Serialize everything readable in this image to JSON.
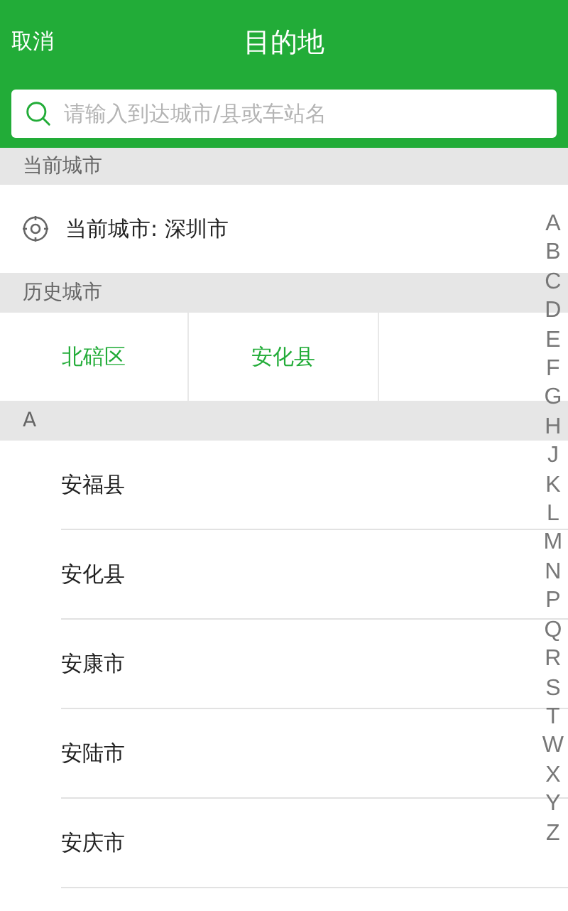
{
  "header": {
    "cancel": "取消",
    "title": "目的地"
  },
  "search": {
    "placeholder": "请输入到达城市/县或车站名"
  },
  "current_section": {
    "heading": "当前城市",
    "label": "当前城市: 深圳市"
  },
  "history_section": {
    "heading": "历史城市",
    "cities": [
      "北碚区",
      "安化县"
    ]
  },
  "groups": [
    {
      "letter": "A",
      "cities": [
        "安福县",
        "安化县",
        "安康市",
        "安陆市",
        "安庆市"
      ]
    }
  ],
  "index_letters": [
    "A",
    "B",
    "C",
    "D",
    "E",
    "F",
    "G",
    "H",
    "J",
    "K",
    "L",
    "M",
    "N",
    "P",
    "Q",
    "R",
    "S",
    "T",
    "W",
    "X",
    "Y",
    "Z"
  ]
}
